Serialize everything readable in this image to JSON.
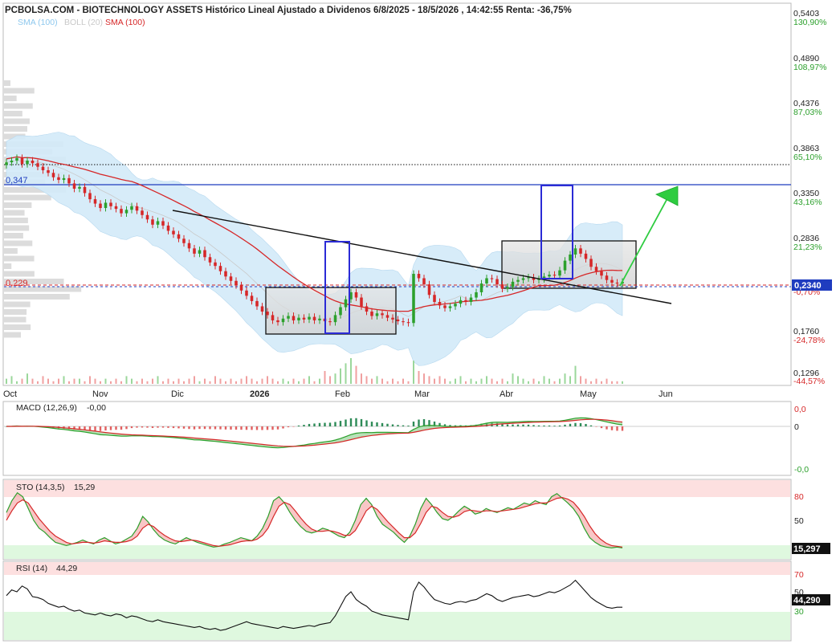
{
  "header": {
    "title": "PCBOLSA.COM - BIOTECHNOLOGY ASSETS Histórico Lineal Ajustado a Dividenos 6/8/2025 - 18/5/2026 , 14:42:55 Renta: -36,75%",
    "legend_sma1": "SMA (100)",
    "legend_boll": "BOLL (20)",
    "legend_sma2": "SMA (100)"
  },
  "colors": {
    "up": "#2ca02c",
    "down": "#d62728",
    "sma": "#d62728",
    "boll_fill": "#cfe8f7",
    "level_line": "#1f3cbf",
    "box_stroke": "#111111",
    "measure_box": "#2b2bd6",
    "target_arrow": "#2ecc40"
  },
  "chart_data": [
    {
      "type": "candlestick",
      "title": "PCBOLSA.COM - BIOTECHNOLOGY ASSETS Histórico Lineal Ajustado a Dividenos 6/8/2025 - 18/5/2026 , 14:42:55 Renta: -36,75%",
      "y_axis": {
        "ticks": [
          {
            "price": "0,5403",
            "pct": "130,90%"
          },
          {
            "price": "0,4890",
            "pct": "108,97%"
          },
          {
            "price": "0,4376",
            "pct": "87,03%"
          },
          {
            "price": "0,3863",
            "pct": "65,10%"
          },
          {
            "price": "0,3350",
            "pct": "43,16%"
          },
          {
            "price": "0,2836",
            "pct": "21,23%"
          },
          {
            "price": "",
            "pct": "-0,70%"
          },
          {
            "price": "0,1760",
            "pct": "-24,78%"
          },
          {
            "price": "0,1296",
            "pct": "-44,57%"
          }
        ],
        "ylim": [
          0.1296,
          0.5403
        ]
      },
      "x_axis": {
        "labels": [
          "Oct",
          "Nov",
          "Dic",
          "2026",
          "Feb",
          "Mar",
          "Abr",
          "May",
          "Jun"
        ]
      },
      "last_price": "0,2340",
      "levels": [
        {
          "label": "0,347",
          "value": 0.347
        },
        {
          "label": "0,229",
          "value": 0.229
        }
      ],
      "close": [
        0.37,
        0.372,
        0.375,
        0.368,
        0.372,
        0.369,
        0.365,
        0.361,
        0.358,
        0.353,
        0.35,
        0.352,
        0.346,
        0.34,
        0.342,
        0.335,
        0.328,
        0.323,
        0.318,
        0.324,
        0.32,
        0.317,
        0.312,
        0.316,
        0.32,
        0.315,
        0.31,
        0.305,
        0.299,
        0.303,
        0.298,
        0.292,
        0.288,
        0.283,
        0.278,
        0.272,
        0.266,
        0.27,
        0.262,
        0.256,
        0.252,
        0.246,
        0.24,
        0.235,
        0.23,
        0.224,
        0.218,
        0.212,
        0.206,
        0.2,
        0.196,
        0.19,
        0.188,
        0.192,
        0.195,
        0.19,
        0.193,
        0.191,
        0.194,
        0.19,
        0.192,
        0.189,
        0.188,
        0.196,
        0.205,
        0.214,
        0.222,
        0.216,
        0.206,
        0.2,
        0.195,
        0.198,
        0.196,
        0.193,
        0.191,
        0.189,
        0.188,
        0.187,
        0.243,
        0.238,
        0.231,
        0.219,
        0.211,
        0.207,
        0.204,
        0.206,
        0.209,
        0.213,
        0.211,
        0.216,
        0.222,
        0.232,
        0.238,
        0.237,
        0.231,
        0.226,
        0.228,
        0.234,
        0.236,
        0.238,
        0.239,
        0.236,
        0.237,
        0.24,
        0.242,
        0.241,
        0.247,
        0.258,
        0.265,
        0.272,
        0.266,
        0.26,
        0.251,
        0.246,
        0.241,
        0.236,
        0.233,
        0.232,
        0.234
      ],
      "volume": [
        0.2,
        0.3,
        0.1,
        0.2,
        0.4,
        0.2,
        0.1,
        0.3,
        0.2,
        0.1,
        0.2,
        0.3,
        0.1,
        0.2,
        0.2,
        0.1,
        0.3,
        0.2,
        0.1,
        0.2,
        0.1,
        0.2,
        0.1,
        0.3,
        0.2,
        0.1,
        0.2,
        0.1,
        0.2,
        0.3,
        0.1,
        0.2,
        0.1,
        0.2,
        0.1,
        0.2,
        0.3,
        0.1,
        0.2,
        0.1,
        0.3,
        0.2,
        0.1,
        0.2,
        0.1,
        0.2,
        0.3,
        0.2,
        0.1,
        0.2,
        0.3,
        0.2,
        0.1,
        0.2,
        0.1,
        0.2,
        0.1,
        0.2,
        0.3,
        0.1,
        0.2,
        0.5,
        0.3,
        0.4,
        0.6,
        0.8,
        1.0,
        0.7,
        0.4,
        0.3,
        0.2,
        0.3,
        0.2,
        0.1,
        0.2,
        0.1,
        0.2,
        0.1,
        0.9,
        0.5,
        0.4,
        0.3,
        0.2,
        0.3,
        0.2,
        0.1,
        0.2,
        0.3,
        0.1,
        0.2,
        0.1,
        0.2,
        0.3,
        0.2,
        0.1,
        0.2,
        0.1,
        0.4,
        0.3,
        0.2,
        0.1,
        0.2,
        0.1,
        0.3,
        0.2,
        0.1,
        0.2,
        0.4,
        0.3,
        0.7,
        0.3,
        0.2,
        0.1,
        0.2,
        0.1,
        0.2,
        0.1,
        0.1,
        0.1
      ]
    },
    {
      "type": "line",
      "title": "MACD (12,26,9)",
      "value_label": "-0,00",
      "y_ticks": [
        "0,0",
        "0",
        "-0,0"
      ]
    },
    {
      "type": "line",
      "title": "STO (14,3,5)",
      "value_label": "15,29",
      "y_ticks": [
        "80",
        "50"
      ],
      "last": "15,297",
      "k": [
        60,
        75,
        85,
        80,
        65,
        50,
        40,
        35,
        28,
        22,
        20,
        18,
        20,
        22,
        25,
        22,
        20,
        25,
        28,
        24,
        20,
        22,
        26,
        30,
        40,
        55,
        48,
        38,
        30,
        25,
        22,
        20,
        24,
        28,
        25,
        22,
        20,
        18,
        16,
        17,
        20,
        22,
        25,
        28,
        26,
        24,
        30,
        40,
        55,
        75,
        80,
        72,
        60,
        50,
        42,
        36,
        34,
        36,
        40,
        38,
        34,
        30,
        28,
        35,
        50,
        70,
        78,
        70,
        55,
        45,
        40,
        35,
        28,
        22,
        30,
        45,
        65,
        78,
        70,
        60,
        52,
        50,
        55,
        62,
        68,
        64,
        58,
        60,
        65,
        62,
        60,
        63,
        66,
        64,
        68,
        72,
        70,
        75,
        72,
        70,
        80,
        84,
        78,
        72,
        65,
        55,
        40,
        28,
        22,
        18,
        16,
        15,
        16,
        15
      ],
      "d": [
        50,
        62,
        72,
        76,
        72,
        62,
        52,
        44,
        36,
        30,
        26,
        22,
        20,
        21,
        22,
        22,
        21,
        22,
        24,
        23,
        22,
        22,
        23,
        25,
        30,
        40,
        45,
        42,
        36,
        31,
        27,
        24,
        23,
        24,
        25,
        24,
        22,
        20,
        18,
        17,
        18,
        19,
        21,
        23,
        24,
        24,
        26,
        31,
        40,
        55,
        68,
        73,
        70,
        62,
        53,
        45,
        39,
        36,
        36,
        37,
        36,
        34,
        31,
        31,
        37,
        49,
        62,
        68,
        64,
        56,
        48,
        41,
        34,
        28,
        28,
        34,
        46,
        60,
        68,
        66,
        60,
        55,
        54,
        56,
        61,
        63,
        62,
        61,
        62,
        62,
        61,
        62,
        63,
        64,
        65,
        67,
        69,
        71,
        72,
        72,
        75,
        78,
        79,
        77,
        73,
        65,
        55,
        43,
        33,
        26,
        21,
        18,
        17,
        16
      ]
    },
    {
      "type": "line",
      "title": "RSI (14)",
      "value_label": "44,29",
      "y_ticks": [
        "70",
        "50",
        "30"
      ],
      "last": "44,290",
      "values": [
        56,
        62,
        60,
        66,
        63,
        55,
        54,
        52,
        48,
        46,
        44,
        45,
        42,
        40,
        41,
        38,
        37,
        36,
        38,
        36,
        35,
        37,
        36,
        33,
        35,
        34,
        32,
        30,
        29,
        31,
        29,
        28,
        27,
        26,
        25,
        24,
        23,
        24,
        22,
        21,
        22,
        20,
        21,
        23,
        25,
        27,
        29,
        27,
        26,
        25,
        24,
        23,
        22,
        24,
        23,
        22,
        23,
        24,
        25,
        24,
        26,
        27,
        28,
        35,
        45,
        55,
        60,
        52,
        48,
        45,
        40,
        38,
        36,
        35,
        34,
        33,
        32,
        31,
        60,
        70,
        65,
        58,
        52,
        50,
        48,
        47,
        49,
        50,
        49,
        51,
        52,
        55,
        58,
        56,
        52,
        50,
        52,
        54,
        55,
        56,
        57,
        55,
        56,
        58,
        60,
        59,
        61,
        64,
        67,
        72,
        66,
        60,
        54,
        50,
        47,
        44,
        43,
        44,
        44
      ]
    }
  ]
}
